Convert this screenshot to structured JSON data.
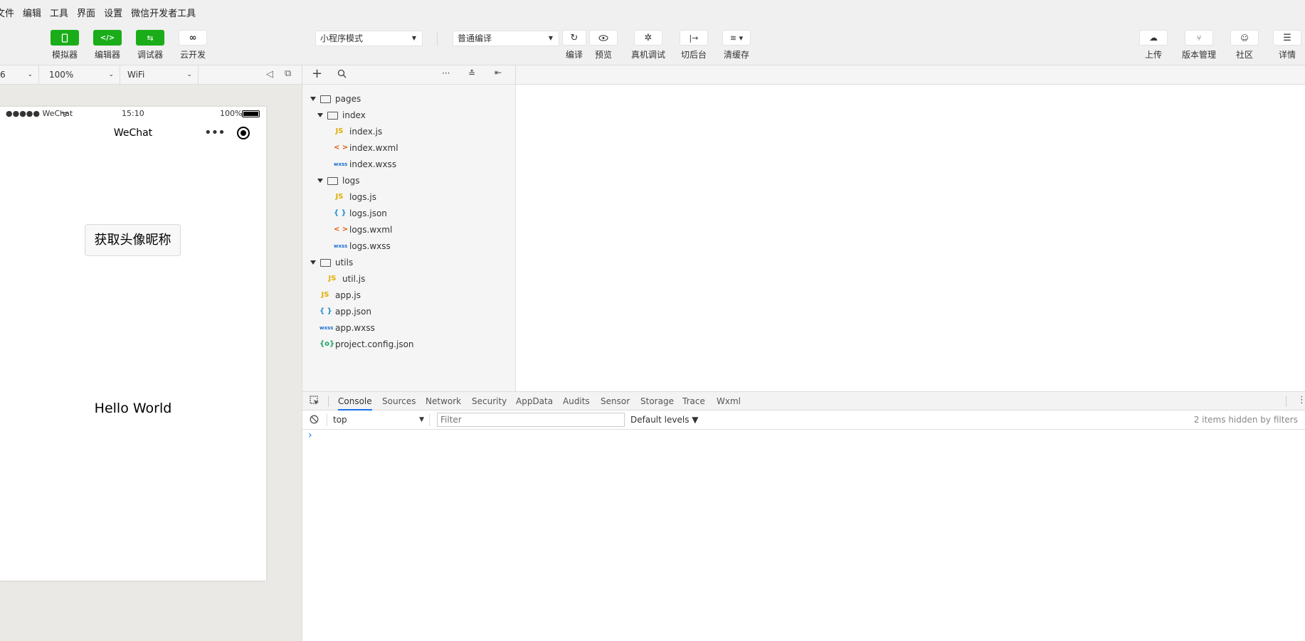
{
  "menu": [
    "文件",
    "编辑",
    "工具",
    "界面",
    "设置",
    "微信开发者工具"
  ],
  "toolbar": {
    "simulator": "模拟器",
    "editor": "编辑器",
    "debugger": "调试器",
    "cloud": "云开发",
    "mode_select": "小程序模式",
    "compile_select": "普通编译",
    "compile": "编译",
    "preview": "预览",
    "remote_debug": "真机调试",
    "background": "切后台",
    "clear_cache": "清缓存",
    "upload": "上传",
    "version": "版本管理",
    "community": "社区",
    "details": "详情"
  },
  "simbar": {
    "device": "6",
    "zoom": "100%",
    "network": "WiFi"
  },
  "phone": {
    "carrier": "●●●●● WeChat",
    "time": "15:10",
    "battery": "100%",
    "nav_title": "WeChat",
    "capsule_dots": "•••",
    "button_label": "获取头像昵称",
    "hello": "Hello World"
  },
  "tree": [
    {
      "label": "pages",
      "type": "folder",
      "depth": 0
    },
    {
      "label": "index",
      "type": "folder",
      "depth": 1
    },
    {
      "label": "index.js",
      "type": "js",
      "depth": 2
    },
    {
      "label": "index.wxml",
      "type": "wxml",
      "depth": 2
    },
    {
      "label": "index.wxss",
      "type": "wxss",
      "depth": 2
    },
    {
      "label": "logs",
      "type": "folder",
      "depth": 1
    },
    {
      "label": "logs.js",
      "type": "js",
      "depth": 2
    },
    {
      "label": "logs.json",
      "type": "json",
      "depth": 2
    },
    {
      "label": "logs.wxml",
      "type": "wxml",
      "depth": 2
    },
    {
      "label": "logs.wxss",
      "type": "wxss",
      "depth": 2
    },
    {
      "label": "utils",
      "type": "folder",
      "depth": 0
    },
    {
      "label": "util.js",
      "type": "js",
      "depth": 1
    },
    {
      "label": "app.js",
      "type": "js",
      "depth": 0
    },
    {
      "label": "app.json",
      "type": "json",
      "depth": 0
    },
    {
      "label": "app.wxss",
      "type": "wxss",
      "depth": 0
    },
    {
      "label": "project.config.json",
      "type": "cfg",
      "depth": 0
    }
  ],
  "file_icons": {
    "js": "JS",
    "wxml": "< >",
    "wxss": "wxss",
    "json": "{ }",
    "cfg": "{o}"
  },
  "devtools": {
    "tabs": [
      "Console",
      "Sources",
      "Network",
      "Security",
      "AppData",
      "Audits",
      "Sensor",
      "Storage",
      "Trace",
      "Wxml"
    ],
    "context": "top",
    "filter_placeholder": "Filter",
    "levels": "Default levels ▼",
    "hidden": "2 items hidden by filters",
    "prompt": "›"
  }
}
